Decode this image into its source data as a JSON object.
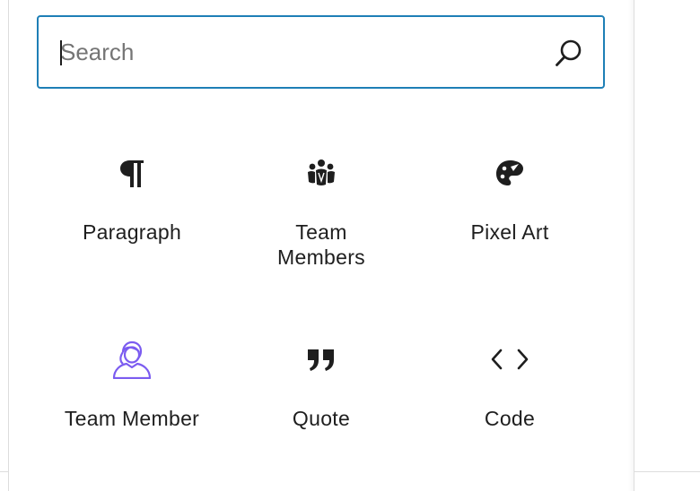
{
  "search": {
    "placeholder": "Search",
    "value": ""
  },
  "blocks": [
    {
      "label": "Paragraph",
      "icon": "paragraph-icon"
    },
    {
      "label": "Team Members",
      "icon": "team-members-icon"
    },
    {
      "label": "Pixel Art",
      "icon": "palette-icon"
    },
    {
      "label": "Team Member",
      "icon": "team-member-icon",
      "icon_color": "#7b5cf0"
    },
    {
      "label": "Quote",
      "icon": "quote-icon"
    },
    {
      "label": "Code",
      "icon": "code-icon"
    }
  ],
  "colors": {
    "accent": "#1e7fb6",
    "text": "#1e1e1e",
    "placeholder": "#757575",
    "team_member_icon": "#7b5cf0"
  }
}
